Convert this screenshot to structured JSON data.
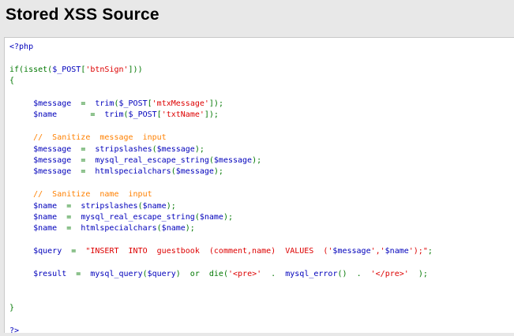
{
  "page": {
    "title": "Stored XSS Source"
  },
  "colors": {
    "default": "#0000bb",
    "keyword": "#007700",
    "string": "#dd0000",
    "comment": "#ff8000"
  },
  "code": {
    "lines": [
      {
        "tokens": [
          {
            "t": "<?php",
            "c": "default"
          }
        ]
      },
      {
        "tokens": []
      },
      {
        "tokens": [
          {
            "t": "if(isset(",
            "c": "kw"
          },
          {
            "t": "$_POST",
            "c": "default"
          },
          {
            "t": "[",
            "c": "kw"
          },
          {
            "t": "'btnSign'",
            "c": "str"
          },
          {
            "t": "]))",
            "c": "kw"
          }
        ]
      },
      {
        "tokens": [
          {
            "t": "{",
            "c": "kw"
          }
        ]
      },
      {
        "tokens": []
      },
      {
        "tokens": [
          {
            "t": "     $message  ",
            "c": "default"
          },
          {
            "t": "=  ",
            "c": "kw"
          },
          {
            "t": "trim",
            "c": "default"
          },
          {
            "t": "(",
            "c": "kw"
          },
          {
            "t": "$_POST",
            "c": "default"
          },
          {
            "t": "[",
            "c": "kw"
          },
          {
            "t": "'mtxMessage'",
            "c": "str"
          },
          {
            "t": "]);",
            "c": "kw"
          }
        ]
      },
      {
        "tokens": [
          {
            "t": "     $name       ",
            "c": "default"
          },
          {
            "t": "=  ",
            "c": "kw"
          },
          {
            "t": "trim",
            "c": "default"
          },
          {
            "t": "(",
            "c": "kw"
          },
          {
            "t": "$_POST",
            "c": "default"
          },
          {
            "t": "[",
            "c": "kw"
          },
          {
            "t": "'txtName'",
            "c": "str"
          },
          {
            "t": "]);",
            "c": "kw"
          }
        ]
      },
      {
        "tokens": []
      },
      {
        "tokens": [
          {
            "t": "     //  Sanitize  message  input",
            "c": "com"
          }
        ]
      },
      {
        "tokens": [
          {
            "t": "     $message  ",
            "c": "default"
          },
          {
            "t": "=  ",
            "c": "kw"
          },
          {
            "t": "stripslashes",
            "c": "default"
          },
          {
            "t": "(",
            "c": "kw"
          },
          {
            "t": "$message",
            "c": "default"
          },
          {
            "t": ");",
            "c": "kw"
          }
        ]
      },
      {
        "tokens": [
          {
            "t": "     $message  ",
            "c": "default"
          },
          {
            "t": "=  ",
            "c": "kw"
          },
          {
            "t": "mysql_real_escape_string",
            "c": "default"
          },
          {
            "t": "(",
            "c": "kw"
          },
          {
            "t": "$message",
            "c": "default"
          },
          {
            "t": ");",
            "c": "kw"
          }
        ]
      },
      {
        "tokens": [
          {
            "t": "     $message  ",
            "c": "default"
          },
          {
            "t": "=  ",
            "c": "kw"
          },
          {
            "t": "htmlspecialchars",
            "c": "default"
          },
          {
            "t": "(",
            "c": "kw"
          },
          {
            "t": "$message",
            "c": "default"
          },
          {
            "t": ");",
            "c": "kw"
          }
        ]
      },
      {
        "tokens": []
      },
      {
        "tokens": [
          {
            "t": "     //  Sanitize  name  input",
            "c": "com"
          }
        ]
      },
      {
        "tokens": [
          {
            "t": "     $name  ",
            "c": "default"
          },
          {
            "t": "=  ",
            "c": "kw"
          },
          {
            "t": "stripslashes",
            "c": "default"
          },
          {
            "t": "(",
            "c": "kw"
          },
          {
            "t": "$name",
            "c": "default"
          },
          {
            "t": ");",
            "c": "kw"
          }
        ]
      },
      {
        "tokens": [
          {
            "t": "     $name  ",
            "c": "default"
          },
          {
            "t": "=  ",
            "c": "kw"
          },
          {
            "t": "mysql_real_escape_string",
            "c": "default"
          },
          {
            "t": "(",
            "c": "kw"
          },
          {
            "t": "$name",
            "c": "default"
          },
          {
            "t": ");",
            "c": "kw"
          }
        ]
      },
      {
        "tokens": [
          {
            "t": "     $name  ",
            "c": "default"
          },
          {
            "t": "=  ",
            "c": "kw"
          },
          {
            "t": "htmlspecialchars",
            "c": "default"
          },
          {
            "t": "(",
            "c": "kw"
          },
          {
            "t": "$name",
            "c": "default"
          },
          {
            "t": ");",
            "c": "kw"
          }
        ]
      },
      {
        "tokens": []
      },
      {
        "tokens": [
          {
            "t": "     $query  ",
            "c": "default"
          },
          {
            "t": "=  ",
            "c": "kw"
          },
          {
            "t": "\"INSERT  INTO  guestbook  (comment,name)  VALUES  ('",
            "c": "str"
          },
          {
            "t": "$message",
            "c": "default"
          },
          {
            "t": "','",
            "c": "str"
          },
          {
            "t": "$name",
            "c": "default"
          },
          {
            "t": "');\"",
            "c": "str"
          },
          {
            "t": ";",
            "c": "kw"
          }
        ]
      },
      {
        "tokens": []
      },
      {
        "tokens": [
          {
            "t": "     $result  ",
            "c": "default"
          },
          {
            "t": "=  ",
            "c": "kw"
          },
          {
            "t": "mysql_query",
            "c": "default"
          },
          {
            "t": "(",
            "c": "kw"
          },
          {
            "t": "$query",
            "c": "default"
          },
          {
            "t": ")  or  die(",
            "c": "kw"
          },
          {
            "t": "'<pre>'",
            "c": "str"
          },
          {
            "t": "  .  ",
            "c": "kw"
          },
          {
            "t": "mysql_error",
            "c": "default"
          },
          {
            "t": "()  .  ",
            "c": "kw"
          },
          {
            "t": "'</pre>'",
            "c": "str"
          },
          {
            "t": "  );",
            "c": "kw"
          }
        ]
      },
      {
        "tokens": []
      },
      {
        "tokens": []
      },
      {
        "tokens": [
          {
            "t": "}",
            "c": "kw"
          }
        ]
      },
      {
        "tokens": []
      },
      {
        "tokens": [
          {
            "t": "?>",
            "c": "default"
          }
        ]
      }
    ]
  }
}
